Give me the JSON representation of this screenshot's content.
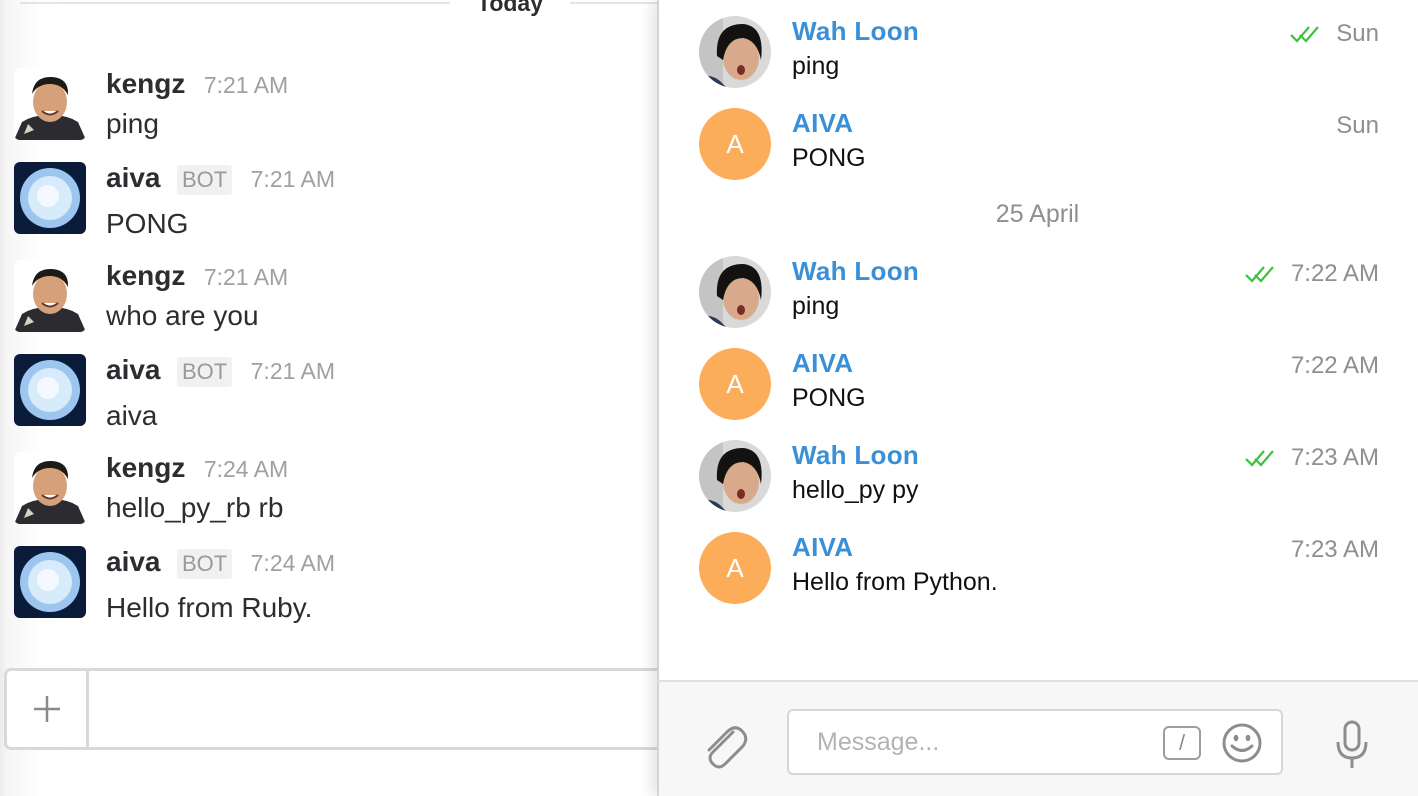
{
  "left_panel": {
    "day_label": "Today",
    "messages": [
      {
        "name": "kengz",
        "time": "7:21 AM",
        "text": "ping",
        "bot": false
      },
      {
        "name": "aiva",
        "bot_badge": "BOT",
        "time": "7:21 AM",
        "text": "PONG",
        "bot": true
      },
      {
        "name": "kengz",
        "time": "7:21 AM",
        "text": "who are you",
        "bot": false
      },
      {
        "name": "aiva",
        "bot_badge": "BOT",
        "time": "7:21 AM",
        "text": "aiva",
        "bot": true
      },
      {
        "name": "kengz",
        "time": "7:24 AM",
        "text": "hello_py_rb rb",
        "bot": false
      },
      {
        "name": "aiva",
        "bot_badge": "BOT",
        "time": "7:24 AM",
        "text": "Hello from Ruby.",
        "bot": true
      }
    ],
    "composer": {
      "plus_icon": "plus-icon",
      "input_value": ""
    }
  },
  "right_panel": {
    "messages": [
      {
        "name": "Wah Loon",
        "text": "ping",
        "time": "Sun",
        "read_receipt": true,
        "avatar": "photo"
      },
      {
        "name": "AIVA",
        "text": "PONG",
        "time": "Sun",
        "read_receipt": false,
        "avatar": "A"
      },
      {
        "name": "Wah Loon",
        "text": "ping",
        "time": "7:22 AM",
        "read_receipt": true,
        "avatar": "photo"
      },
      {
        "name": "AIVA",
        "text": "PONG",
        "time": "7:22 AM",
        "read_receipt": false,
        "avatar": "A"
      },
      {
        "name": "Wah Loon",
        "text": "hello_py py",
        "time": "7:23 AM",
        "read_receipt": true,
        "avatar": "photo"
      },
      {
        "name": "AIVA",
        "text": "Hello from Python.",
        "time": "7:23 AM",
        "read_receipt": false,
        "avatar": "A"
      }
    ],
    "date_separator": "25 April",
    "composer": {
      "placeholder": "Message...",
      "command_symbol": "/",
      "icons": [
        "paperclip-icon",
        "slash-command-icon",
        "emoji-icon",
        "microphone-icon"
      ]
    }
  },
  "colors": {
    "name_blue": "#3a8fd6",
    "letter_avatar_orange": "#fbad5a",
    "read_receipt_green": "#3cc23c",
    "slack_text": "#2c2d30",
    "muted_gray": "#8e8e93"
  }
}
